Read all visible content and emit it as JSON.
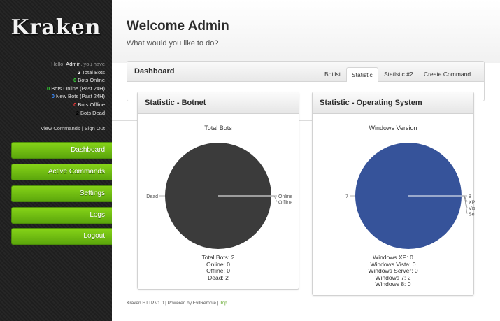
{
  "brand": {
    "logo": "Kraken"
  },
  "sidebar": {
    "greeting_prefix": "Hello, ",
    "user": "Admin",
    "greeting_suffix": ", you have",
    "stats": [
      {
        "count": "2",
        "label": " Total Bots",
        "color": "#ffffff"
      },
      {
        "count": "0",
        "label": " Bots Online",
        "color": "#35d335"
      },
      {
        "count": "0",
        "label": " Bots Online (Past 24H)",
        "color": "#35d335"
      },
      {
        "count": "0",
        "label": " New Bots (Past 24H)",
        "color": "#3a8cff"
      },
      {
        "count": "0",
        "label": " Bots Offline",
        "color": "#ff3a3a"
      },
      {
        "count": "2",
        "label": " Bots Dead",
        "color": "#000000"
      }
    ],
    "view_commands": "View Commands",
    "separator": " | ",
    "sign_out": "Sign Out",
    "nav": [
      {
        "label": "Dashboard"
      },
      {
        "label": "Active Commands"
      },
      {
        "label": "Settings"
      },
      {
        "label": "Logs"
      },
      {
        "label": "Logout"
      }
    ]
  },
  "header": {
    "title": "Welcome Admin",
    "subtitle": "What would you like to do?"
  },
  "dashboard": {
    "title": "Dashboard",
    "tabs": [
      {
        "label": "Botlist",
        "active": false
      },
      {
        "label": "Statistic",
        "active": true
      },
      {
        "label": "Statistic #2",
        "active": false
      },
      {
        "label": "Create Command",
        "active": false
      }
    ]
  },
  "cards": [
    {
      "title": "Statistic - Botnet",
      "chart_title": "Total Bots",
      "summary": [
        "Total Bots: 2",
        "Online: 0",
        "Offline: 0",
        "Dead: 2"
      ]
    },
    {
      "title": "Statistic - Operating System",
      "chart_title": "Windows Version",
      "summary": [
        "Windows XP: 0",
        "Windows Vista: 0",
        "Windows Server: 0",
        "Windows 7: 2",
        "Windows 8: 0"
      ]
    }
  ],
  "chart_data": [
    {
      "type": "pie",
      "title": "Total Bots",
      "categories": [
        "Online",
        "Offline",
        "Dead"
      ],
      "values": [
        0,
        0,
        2
      ],
      "colors": [
        "#5a8c2a",
        "#c02020",
        "#3b3b3b"
      ]
    },
    {
      "type": "pie",
      "title": "Windows Version",
      "categories": [
        "8",
        "XP",
        "Vista",
        "Server",
        "7"
      ],
      "values": [
        0,
        0,
        0,
        0,
        2
      ],
      "colors": [
        "#aaaaaa",
        "#c04040",
        "#60a030",
        "#d0a020",
        "#36539a"
      ]
    }
  ],
  "footer": {
    "text": "Kraken HTTP v1.0 | Powered by EvilRemote | ",
    "top_link": "Top"
  }
}
